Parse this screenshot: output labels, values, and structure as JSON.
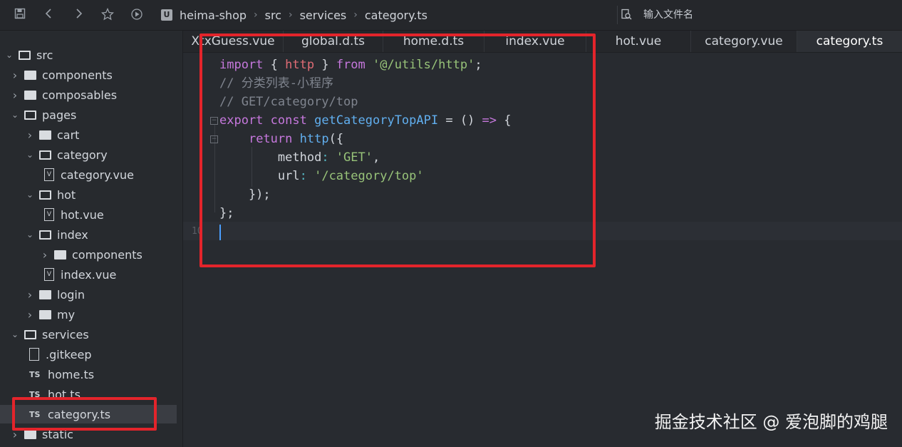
{
  "toolbar": {
    "icons": [
      "save-icon",
      "back-icon",
      "forward-icon",
      "star-icon",
      "run-icon"
    ],
    "breadcrumb": [
      "heima-shop",
      "src",
      "services",
      "category.ts"
    ],
    "logo_text": "U",
    "file_search_placeholder": "输入文件名"
  },
  "sidebar": {
    "items": [
      {
        "label": "src",
        "type": "folder-open",
        "depth": 0
      },
      {
        "label": "components",
        "type": "folder",
        "depth": 1
      },
      {
        "label": "composables",
        "type": "folder",
        "depth": 1
      },
      {
        "label": "pages",
        "type": "folder-open",
        "depth": 1
      },
      {
        "label": "cart",
        "type": "folder",
        "depth": 2
      },
      {
        "label": "category",
        "type": "folder-open",
        "depth": 2
      },
      {
        "label": "category.vue",
        "type": "vue",
        "depth": 3
      },
      {
        "label": "hot",
        "type": "folder-open",
        "depth": 2
      },
      {
        "label": "hot.vue",
        "type": "vue",
        "depth": 3
      },
      {
        "label": "index",
        "type": "folder-open",
        "depth": 2
      },
      {
        "label": "components",
        "type": "folder",
        "depth": 3
      },
      {
        "label": "index.vue",
        "type": "vue",
        "depth": 3
      },
      {
        "label": "login",
        "type": "folder",
        "depth": 2
      },
      {
        "label": "my",
        "type": "folder",
        "depth": 2
      },
      {
        "label": "services",
        "type": "folder-open",
        "depth": 1
      },
      {
        "label": ".gitkeep",
        "type": "doc",
        "depth": 2
      },
      {
        "label": "home.ts",
        "type": "ts",
        "depth": 2
      },
      {
        "label": "hot.ts",
        "type": "ts",
        "depth": 2
      },
      {
        "label": "category.ts",
        "type": "ts",
        "depth": 2,
        "selected": true
      },
      {
        "label": "static",
        "type": "folder",
        "depth": 1
      }
    ]
  },
  "tabs": [
    {
      "label": "XtxGuess.vue"
    },
    {
      "label": "global.d.ts"
    },
    {
      "label": "home.d.ts"
    },
    {
      "label": "index.vue"
    },
    {
      "label": "hot.vue"
    },
    {
      "label": "category.vue"
    },
    {
      "label": "category.ts",
      "active": true
    }
  ],
  "editor": {
    "line_number_visible": "10",
    "code": {
      "l1": {
        "kw1": "import",
        "p1": " { ",
        "id": "http",
        "p2": " } ",
        "kw2": "from",
        "sp": " ",
        "str": "'@/utils/http'",
        "end": ";"
      },
      "l2": {
        "comment": "// 分类列表-小程序"
      },
      "l3": {
        "comment": "// GET/category/top"
      },
      "l4": {
        "kw1": "export",
        "sp1": " ",
        "kw2": "const",
        "sp2": " ",
        "fn": "getCategoryTopAPI",
        "p1": " = () ",
        "arrow": "=>",
        "p2": " {"
      },
      "l5": {
        "indent": "    ",
        "kw": "return",
        "sp": " ",
        "fn": "http",
        "p": "({"
      },
      "l6": {
        "indent": "        ",
        "prop": "method",
        "colon": ": ",
        "str": "'GET'",
        "end": ","
      },
      "l7": {
        "indent": "        ",
        "prop": "url",
        "colon": ": ",
        "str": "'/category/top'"
      },
      "l8": {
        "text": "    });"
      },
      "l9": {
        "text": "};"
      }
    }
  },
  "watermark": "掘金技术社区 @ 爱泡脚的鸡腿",
  "colors": {
    "annotation": "#e3242b",
    "keyword": "#c678dd",
    "function": "#61afef",
    "string": "#98c379",
    "comment": "#7f848e"
  }
}
